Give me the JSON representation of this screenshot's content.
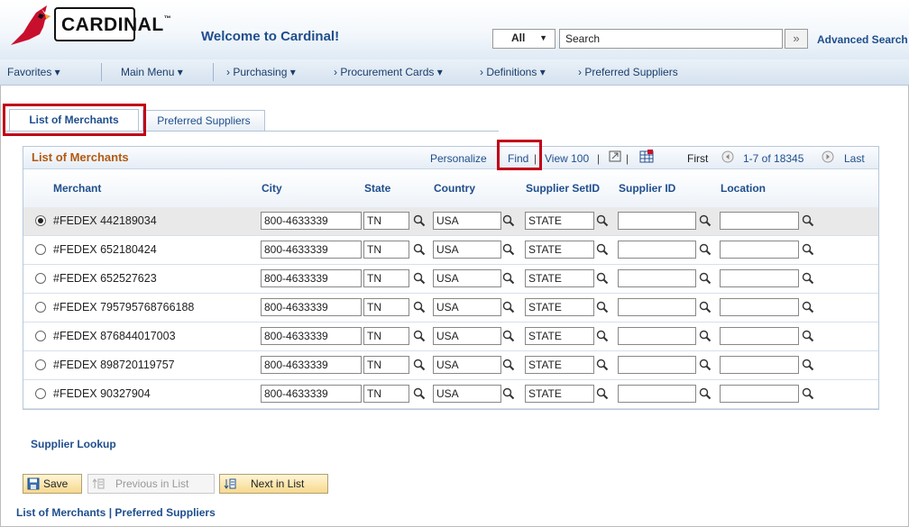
{
  "header": {
    "logo_text": "CARDINAL",
    "logo_tm": "™",
    "welcome": "Welcome to Cardinal!",
    "search_scope": "All",
    "search_value": "Search",
    "advanced_search": "Advanced Search"
  },
  "nav": {
    "favorites": "Favorites ▾",
    "main_menu": "Main Menu ▾",
    "crumbs": [
      "›  Purchasing ▾",
      "›  Procurement Cards ▾",
      "›  Definitions ▾",
      "›  Preferred Suppliers"
    ]
  },
  "tabs": {
    "active": "List of Merchants",
    "inactive": "Preferred Suppliers"
  },
  "grid": {
    "title": "List of Merchants",
    "personalize": "Personalize",
    "find": "Find",
    "view100": "View 100",
    "first": "First",
    "count": "1-7 of 18345",
    "last": "Last",
    "columns": [
      "Merchant",
      "City",
      "State",
      "Country",
      "Supplier SetID",
      "Supplier ID",
      "Location"
    ],
    "rows": [
      {
        "merchant": "#FEDEX 442189034",
        "city": "800-4633339",
        "state": "TN",
        "country": "USA",
        "setid": "STATE",
        "supplier_id": "",
        "location": "",
        "selected": true
      },
      {
        "merchant": "#FEDEX 652180424",
        "city": "800-4633339",
        "state": "TN",
        "country": "USA",
        "setid": "STATE",
        "supplier_id": "",
        "location": "",
        "selected": false
      },
      {
        "merchant": "#FEDEX 652527623",
        "city": "800-4633339",
        "state": "TN",
        "country": "USA",
        "setid": "STATE",
        "supplier_id": "",
        "location": "",
        "selected": false
      },
      {
        "merchant": "#FEDEX 795795768766188",
        "city": "800-4633339",
        "state": "TN",
        "country": "USA",
        "setid": "STATE",
        "supplier_id": "",
        "location": "",
        "selected": false
      },
      {
        "merchant": "#FEDEX 876844017003",
        "city": "800-4633339",
        "state": "TN",
        "country": "USA",
        "setid": "STATE",
        "supplier_id": "",
        "location": "",
        "selected": false
      },
      {
        "merchant": "#FEDEX 898720119757",
        "city": "800-4633339",
        "state": "TN",
        "country": "USA",
        "setid": "STATE",
        "supplier_id": "",
        "location": "",
        "selected": false
      },
      {
        "merchant": "#FEDEX 90327904",
        "city": "800-4633339",
        "state": "TN",
        "country": "USA",
        "setid": "STATE",
        "supplier_id": "",
        "location": "",
        "selected": false
      }
    ]
  },
  "supplier_lookup": "Supplier Lookup",
  "buttons": {
    "save": "Save",
    "previous": "Previous in List",
    "next": "Next in List"
  },
  "footer": {
    "link1": "List of Merchants",
    "sep": " | ",
    "link2": "Preferred Suppliers"
  },
  "colors": {
    "highlight": "#c00018",
    "link": "#1f4e8c",
    "grid_title": "#b35a10"
  }
}
